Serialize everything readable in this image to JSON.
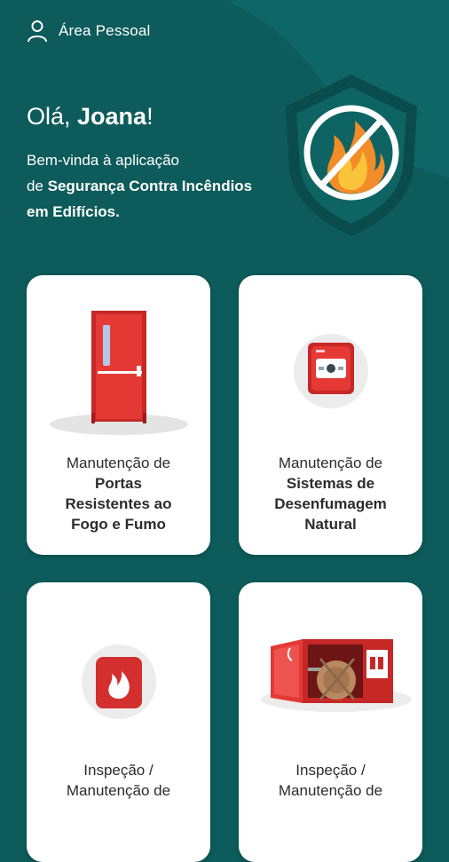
{
  "header": {
    "account_label": "Área Pessoal",
    "account_icon": "user-icon"
  },
  "greeting": {
    "prefix": "Olá, ",
    "name": "Joana",
    "suffix": "!"
  },
  "welcome": {
    "line_part1": "Bem-vinda à aplicação",
    "line_part2": "de ",
    "app_name": "Segurança Contra Incêndios em Edifícios."
  },
  "hero": {
    "icon": "no-fire-shield-icon"
  },
  "cards": [
    {
      "line1": "Manutenção de",
      "bold": [
        "Portas",
        "Resistentes ao",
        "Fogo e Fumo"
      ],
      "icon": "fire-door-icon"
    },
    {
      "line1": "Manutenção de",
      "bold": [
        "Sistemas de",
        "Desenfumagem",
        "Natural"
      ],
      "icon": "smoke-control-button-icon"
    },
    {
      "line1": "Inspeção /",
      "line2": "Manutenção de",
      "icon": "fire-extinguisher-sign-icon"
    },
    {
      "line1": "Inspeção /",
      "line2": "Manutenção de",
      "icon": "fire-hose-cabinet-icon"
    }
  ],
  "colors": {
    "background": "#0d5b5b",
    "accent_red": "#d32f2f",
    "card": "#ffffff"
  }
}
